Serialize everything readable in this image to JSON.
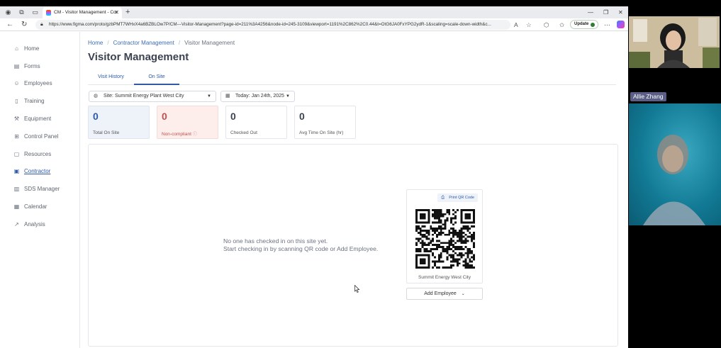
{
  "browser": {
    "tab_title": "CM - Visitor Management - Cor",
    "url": "https://www.figma.com/proto/gzbPMT7WHxX4a6BZBLOw7P/CM---Visitor-Management?page-id=211%3A4256&node-id=245-3109&viewport=1191%2C862%2C0.44&t=OtG6JA0FxYPG2ydR-1&scaling=scale-down-width&c...",
    "update_label": "Update"
  },
  "sidebar": {
    "items": [
      {
        "label": "Home",
        "icon": "home-icon"
      },
      {
        "label": "Forms",
        "icon": "forms-icon"
      },
      {
        "label": "Employees",
        "icon": "employees-icon"
      },
      {
        "label": "Training",
        "icon": "training-icon"
      },
      {
        "label": "Equipment",
        "icon": "equipment-icon"
      },
      {
        "label": "Control Panel",
        "icon": "control-panel-icon"
      },
      {
        "label": "Resources",
        "icon": "resources-icon"
      },
      {
        "label": "Contractor",
        "icon": "contractor-icon",
        "active": true
      },
      {
        "label": "SDS Manager",
        "icon": "sds-icon"
      },
      {
        "label": "Calendar",
        "icon": "calendar-icon"
      },
      {
        "label": "Analysis",
        "icon": "analysis-icon"
      }
    ]
  },
  "breadcrumb": {
    "home": "Home",
    "contractor": "Contractor Management",
    "current": "Visitor Management"
  },
  "page": {
    "title": "Visitor Management"
  },
  "tabs": {
    "visit_history": "Visit History",
    "on_site": "On Site"
  },
  "filters": {
    "site": "Site: Summit Energy Plant West City",
    "date": "Today: Jan 24th, 2025"
  },
  "stats": {
    "total_on_site": {
      "value": "0",
      "label": "Total On Site"
    },
    "non_compliant": {
      "value": "0",
      "label": "Non-compliant"
    },
    "checked_out": {
      "value": "0",
      "label": "Checked Out"
    },
    "avg_time": {
      "value": "0",
      "label": "Avg Time On Site (hr)"
    }
  },
  "empty_state": {
    "line1": "No one has checked in on this site yet.",
    "line2": "Start checking in by scanning QR code or Add Employee."
  },
  "qr": {
    "print_label": "Print QR Code",
    "site_name": "Summit Energy West City"
  },
  "add_employee_label": "Add Employee",
  "video_call": {
    "participant_name": "Allie Zhang"
  },
  "colors": {
    "accent": "#2f5aa8",
    "danger": "#c0504d",
    "danger_bg": "#fdeeec",
    "info_bg": "#eef2f9"
  }
}
